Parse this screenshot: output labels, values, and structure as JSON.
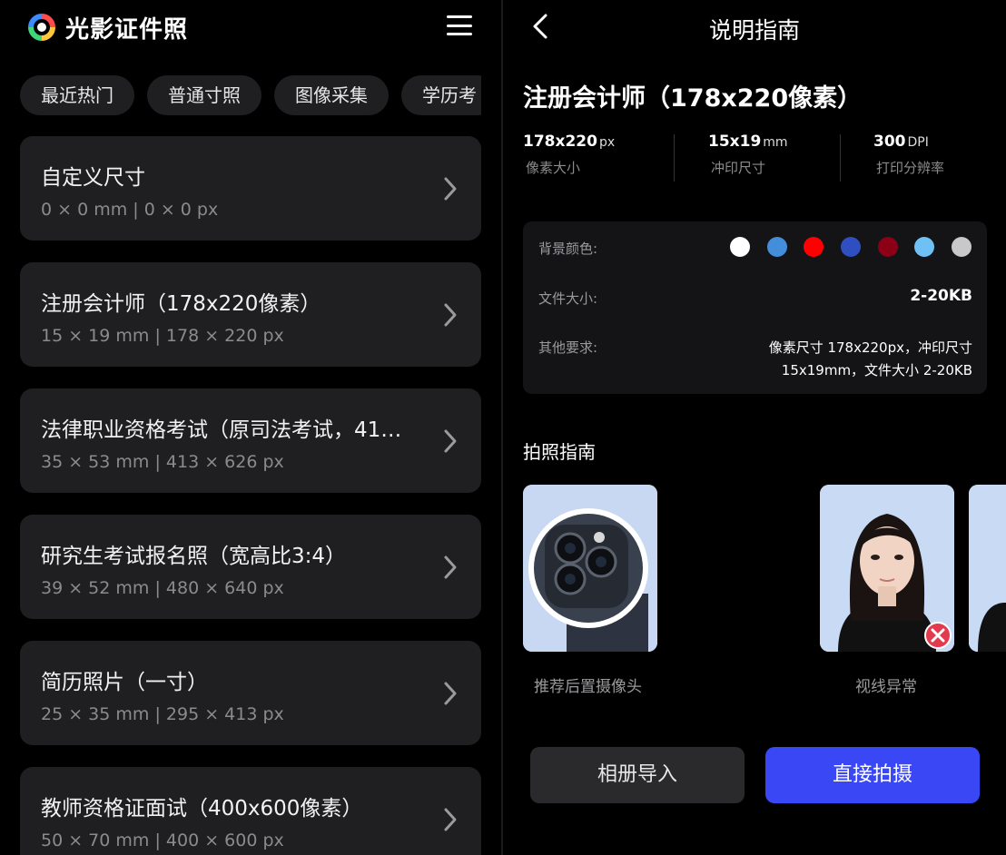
{
  "app": {
    "title": "光影证件照",
    "logo_icon": "rainbow-ring-logo",
    "menu_icon": "hamburger-menu-icon"
  },
  "categories": [
    "最近热门",
    "普通寸照",
    "图像采集",
    "学历考"
  ],
  "items": [
    {
      "title": "自定义尺寸",
      "sub": "0 × 0 mm | 0 × 0 px"
    },
    {
      "title": "注册会计师（178x220像素）",
      "sub": "15 × 19 mm | 178 × 220 px"
    },
    {
      "title": "法律职业资格考试（原司法考试，41…",
      "sub": "35 × 53 mm | 413 × 626 px"
    },
    {
      "title": "研究生考试报名照（宽高比3:4）",
      "sub": "39 × 52 mm | 480 × 640 px"
    },
    {
      "title": "简历照片（一寸）",
      "sub": "25 × 35 mm | 295 × 413 px"
    },
    {
      "title": "教师资格证面试（400x600像素）",
      "sub": "50 × 70 mm | 400 × 600 px"
    }
  ],
  "detail": {
    "page_title": "说明指南",
    "spec_title": "注册会计师（178x220像素）",
    "stats": [
      {
        "value": "178x220",
        "unit": "px",
        "label": "像素大小"
      },
      {
        "value": "15x19",
        "unit": "mm",
        "label": "冲印尺寸"
      },
      {
        "value": "300",
        "unit": "DPI",
        "label": "打印分辨率"
      }
    ],
    "bg_label": "背景颜色:",
    "bg_colors": [
      "#ffffff",
      "#438edb",
      "#ff0000",
      "#2f4fc0",
      "#8b0016",
      "#6fc0f5",
      "#c8c8c8"
    ],
    "size_label": "文件大小:",
    "size_value": "2-20KB",
    "req_label": "其他要求:",
    "req_line1": "像素尺寸 178x220px，冲印尺寸",
    "req_line2": "15x19mm，文件大小 2-20KB",
    "guide_title": "拍照指南",
    "guides": [
      {
        "caption": "推荐后置摄像头",
        "icon": "rear-camera-image"
      },
      {
        "caption": "视线异常",
        "icon": "portrait-wrong-gaze-image"
      }
    ],
    "btn_album": "相册导入",
    "btn_shoot": "直接拍摄",
    "accent": "#3a47f5"
  }
}
